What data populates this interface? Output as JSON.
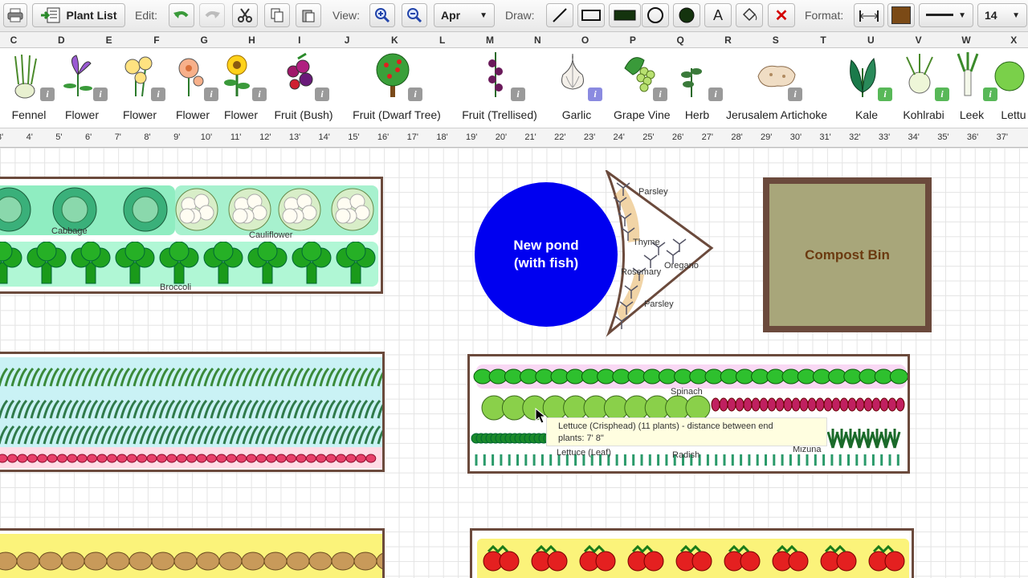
{
  "toolbar": {
    "plant_list_label": "Plant List",
    "edit_label": "Edit:",
    "view_label": "View:",
    "month_value": "Apr",
    "draw_label": "Draw:",
    "text_tool_glyph": "A",
    "delete_glyph": "✕",
    "format_label": "Format:",
    "font_size_value": "14",
    "fill_color": "#7b4a16",
    "delete_color": "#d40000"
  },
  "columns": [
    "C",
    "D",
    "E",
    "F",
    "G",
    "H",
    "I",
    "J",
    "K",
    "L",
    "M",
    "N",
    "O",
    "P",
    "Q",
    "R",
    "S",
    "T",
    "U",
    "V",
    "W",
    "X"
  ],
  "palette": [
    {
      "name": "Fennel",
      "icon": "fennel-icon"
    },
    {
      "name": "Flower",
      "icon": "flower-purple-icon"
    },
    {
      "name": "Flower",
      "icon": "flower-yellow-icon"
    },
    {
      "name": "Flower",
      "icon": "flower-pink-icon"
    },
    {
      "name": "Flower",
      "icon": "sunflower-icon"
    },
    {
      "name": "Fruit (Bush)",
      "icon": "berry-bush-icon"
    },
    {
      "name": "Fruit (Dwarf Tree)",
      "icon": "fruit-tree-icon"
    },
    {
      "name": "Fruit (Trellised)",
      "icon": "trellis-fruit-icon"
    },
    {
      "name": "Garlic",
      "icon": "garlic-icon"
    },
    {
      "name": "Grape Vine",
      "icon": "grape-vine-icon"
    },
    {
      "name": "Herb",
      "icon": "herb-icon"
    },
    {
      "name": "Jerusalem Artichoke",
      "icon": "jerusalem-artichoke-icon"
    },
    {
      "name": "Kale",
      "icon": "kale-icon"
    },
    {
      "name": "Kohlrabi",
      "icon": "kohlrabi-icon"
    },
    {
      "name": "Leek",
      "icon": "leek-icon"
    },
    {
      "name": "Lettu",
      "icon": "lettuce-icon"
    }
  ],
  "ruler": [
    "3'",
    "4'",
    "5'",
    "6'",
    "7'",
    "8'",
    "9'",
    "10'",
    "11'",
    "12'",
    "13'",
    "14'",
    "15'",
    "16'",
    "17'",
    "18'",
    "19'",
    "20'",
    "21'",
    "22'",
    "23'",
    "24'",
    "25'",
    "26'",
    "27'",
    "28'",
    "29'",
    "30'",
    "31'",
    "32'",
    "33'",
    "34'",
    "35'",
    "36'",
    "37'"
  ],
  "garden": {
    "pond_label_line1": "New pond",
    "pond_label_line2": "(with fish)",
    "pond_color": "#0000f0",
    "compost_label": "Compost Bin",
    "labels": {
      "cabbage": "Cabbage",
      "cauliflower": "Cauliflower",
      "broccoli": "Broccoli",
      "parsley_top": "Parsley",
      "thyme": "Thyme",
      "oregano": "Oregano",
      "rosemary": "Rosemary",
      "parsley_bottom": "Parsley",
      "spinach": "Spinach",
      "lettuce_leaf": "Lettuce (Leaf)",
      "radish": "Radish",
      "mizuna": "Mizuna"
    },
    "tooltip_line1": "Lettuce (Crisphead) (11 plants) - distance between end",
    "tooltip_line2": "plants: 7' 8\""
  }
}
